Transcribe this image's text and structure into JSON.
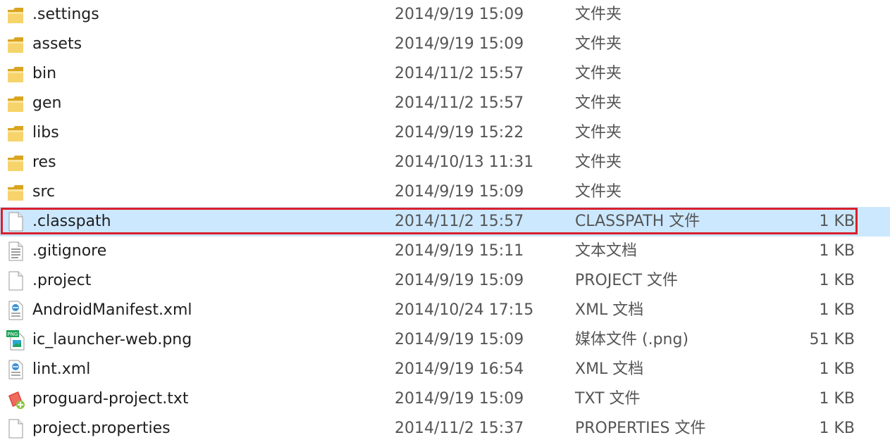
{
  "files": [
    {
      "name": ".settings",
      "date": "2014/9/19 15:09",
      "type": "文件夹",
      "size": "",
      "icon": "folder-icon"
    },
    {
      "name": "assets",
      "date": "2014/9/19 15:09",
      "type": "文件夹",
      "size": "",
      "icon": "folder-icon"
    },
    {
      "name": "bin",
      "date": "2014/11/2 15:57",
      "type": "文件夹",
      "size": "",
      "icon": "folder-icon"
    },
    {
      "name": "gen",
      "date": "2014/11/2 15:57",
      "type": "文件夹",
      "size": "",
      "icon": "folder-icon"
    },
    {
      "name": "libs",
      "date": "2014/9/19 15:22",
      "type": "文件夹",
      "size": "",
      "icon": "folder-icon"
    },
    {
      "name": "res",
      "date": "2014/10/13 11:31",
      "type": "文件夹",
      "size": "",
      "icon": "folder-icon"
    },
    {
      "name": "src",
      "date": "2014/9/19 15:09",
      "type": "文件夹",
      "size": "",
      "icon": "folder-icon"
    },
    {
      "name": ".classpath",
      "date": "2014/11/2 15:57",
      "type": "CLASSPATH 文件",
      "size": "1 KB",
      "icon": "blank-file-icon",
      "selected": true
    },
    {
      "name": ".gitignore",
      "date": "2014/9/19 15:11",
      "type": "文本文档",
      "size": "1 KB",
      "icon": "text-file-icon"
    },
    {
      "name": ".project",
      "date": "2014/9/19 15:09",
      "type": "PROJECT 文件",
      "size": "1 KB",
      "icon": "blank-file-icon"
    },
    {
      "name": "AndroidManifest.xml",
      "date": "2014/10/24 17:15",
      "type": "XML 文档",
      "size": "1 KB",
      "icon": "xml-file-icon"
    },
    {
      "name": "ic_launcher-web.png",
      "date": "2014/9/19 15:09",
      "type": "媒体文件 (.png)",
      "size": "51 KB",
      "icon": "png-file-icon"
    },
    {
      "name": "lint.xml",
      "date": "2014/9/19 16:54",
      "type": "XML 文档",
      "size": "1 KB",
      "icon": "xml-file-icon"
    },
    {
      "name": "proguard-project.txt",
      "date": "2014/9/19 15:09",
      "type": "TXT 文件",
      "size": "1 KB",
      "icon": "notepad-plus-file-icon"
    },
    {
      "name": "project.properties",
      "date": "2014/11/2 15:37",
      "type": "PROPERTIES 文件",
      "size": "1 KB",
      "icon": "blank-file-icon"
    }
  ],
  "colors": {
    "selection": "#cce8ff",
    "highlight_border": "#d9202e",
    "folder": "#f2c94c"
  }
}
